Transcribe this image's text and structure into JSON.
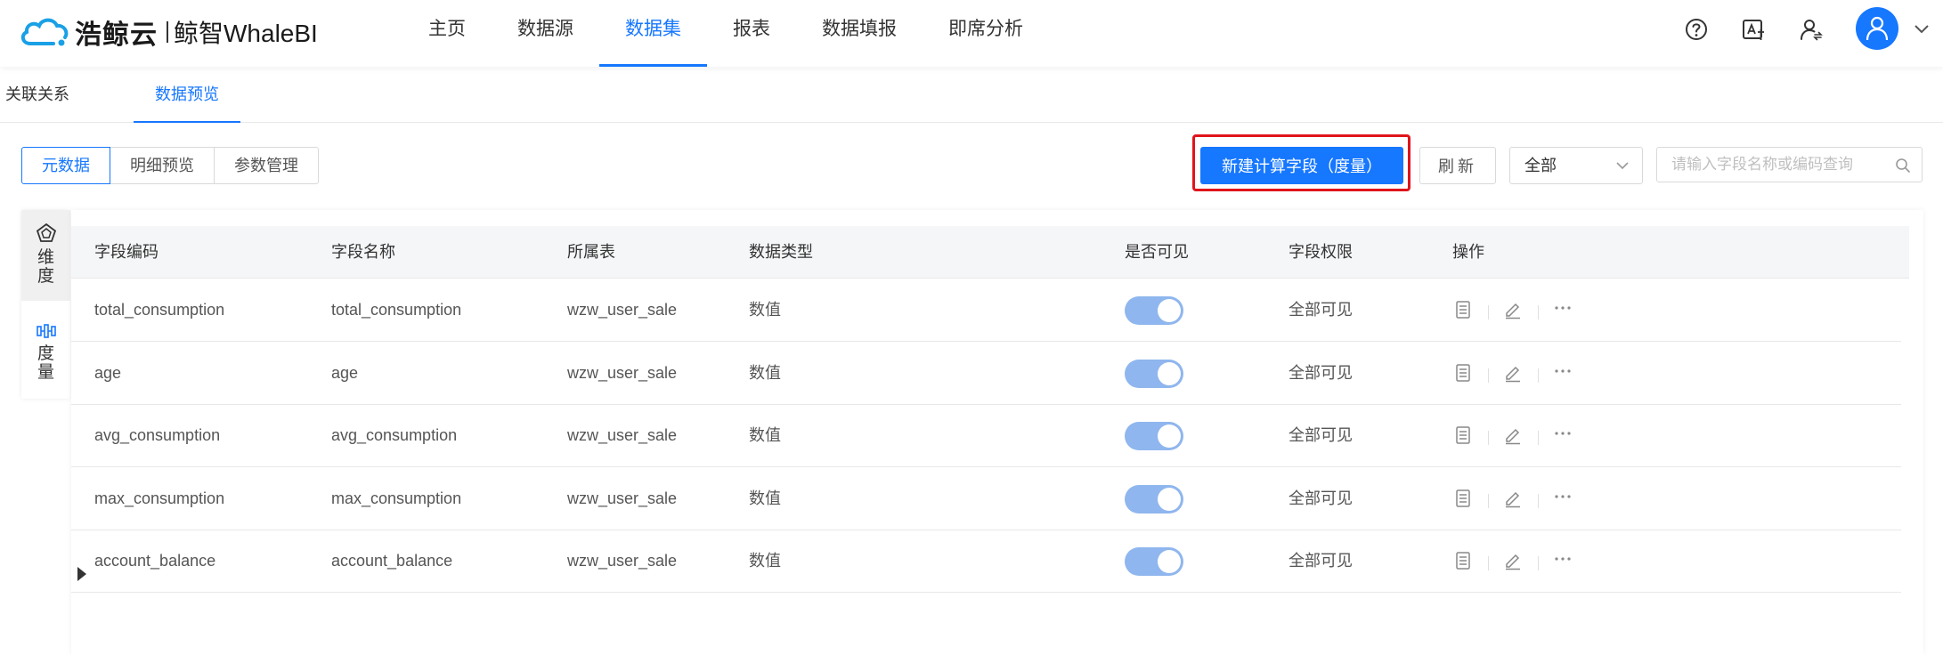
{
  "app": {
    "brand_cn": "浩鲸云",
    "brand_product": "鲸智WhaleBI",
    "nav": [
      {
        "label": "主页",
        "active": false
      },
      {
        "label": "数据源",
        "active": false
      },
      {
        "label": "数据集",
        "active": true
      },
      {
        "label": "报表",
        "active": false
      },
      {
        "label": "数据填报",
        "active": false
      },
      {
        "label": "即席分析",
        "active": false
      }
    ],
    "accent_color": "#1677ff"
  },
  "subtabs": [
    {
      "label": "关联关系",
      "active": false
    },
    {
      "label": "数据预览",
      "active": true
    }
  ],
  "toolbar": {
    "view_tabs": [
      {
        "label": "元数据",
        "active": true
      },
      {
        "label": "明细预览",
        "active": false
      },
      {
        "label": "参数管理",
        "active": false
      }
    ],
    "new_calc_field_label": "新建计算字段（度量）",
    "refresh_label": "刷新",
    "filter_value": "全部",
    "search_placeholder": "请输入字段名称或编码查询"
  },
  "side_tabs": [
    {
      "label": "维度",
      "chars": [
        "维",
        "度"
      ],
      "icon": "pentagon-icon",
      "active": true
    },
    {
      "label": "度量",
      "chars": [
        "度",
        "量"
      ],
      "icon": "measure-bars-icon",
      "active": false
    }
  ],
  "table": {
    "columns": [
      "字段编码",
      "字段名称",
      "所属表",
      "数据类型",
      "是否可见",
      "字段权限",
      "操作"
    ],
    "rows": [
      {
        "code": "total_consumption",
        "name": "total_consumption",
        "table": "wzw_user_sale",
        "type": "数值",
        "visible": true,
        "permission": "全部可见"
      },
      {
        "code": "age",
        "name": "age",
        "table": "wzw_user_sale",
        "type": "数值",
        "visible": true,
        "permission": "全部可见"
      },
      {
        "code": "avg_consumption",
        "name": "avg_consumption",
        "table": "wzw_user_sale",
        "type": "数值",
        "visible": true,
        "permission": "全部可见"
      },
      {
        "code": "max_consumption",
        "name": "max_consumption",
        "table": "wzw_user_sale",
        "type": "数值",
        "visible": true,
        "permission": "全部可见"
      },
      {
        "code": "account_balance",
        "name": "account_balance",
        "table": "wzw_user_sale",
        "type": "数值",
        "visible": true,
        "permission": "全部可见"
      }
    ],
    "row_actions": [
      "detail-list-icon",
      "edit-pencil-icon",
      "more-ellipsis-icon"
    ]
  }
}
